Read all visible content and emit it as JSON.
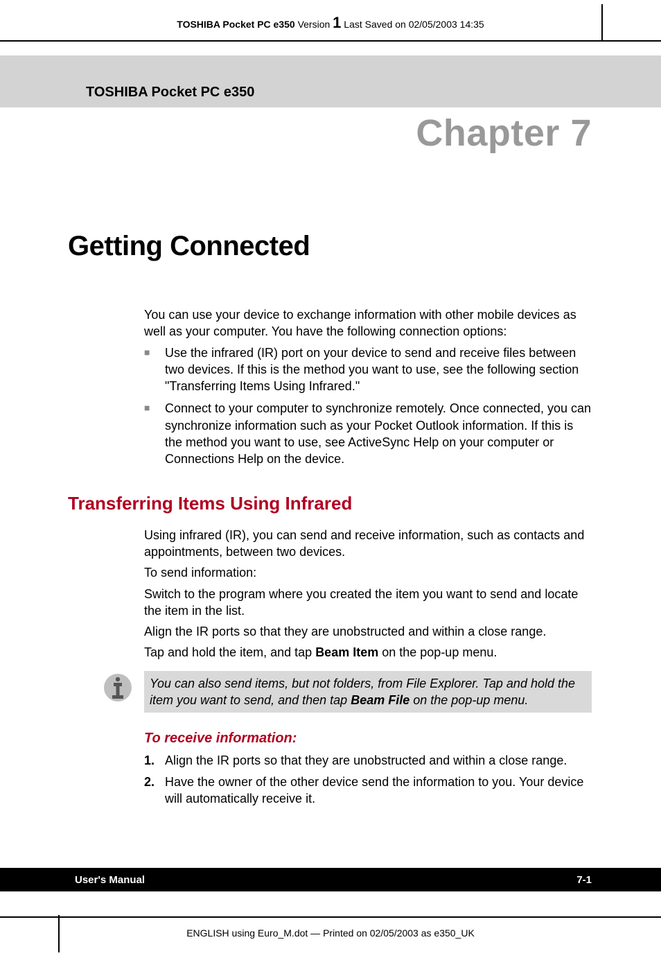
{
  "header": {
    "product_bold": "TOSHIBA Pocket PC e350",
    "version_label": " Version ",
    "version_number": "1",
    "saved_label": "  Last Saved on 02/05/2003 14:35"
  },
  "banner": {
    "product": "TOSHIBA Pocket PC e350"
  },
  "chapter_label": "Chapter 7",
  "chapter_title": "Getting Connected",
  "intro": "You can use your device to exchange information with other mobile devices as well as your computer. You have the following connection options:",
  "bullets": [
    "Use the infrared (IR) port on your device to send and receive files between two devices. If this is the method you want to use, see the following section \"Transferring Items Using Infrared.\"",
    "Connect to your computer to synchronize remotely. Once connected, you can synchronize information such as your Pocket Outlook information. If this is the method you want to use, see ActiveSync Help on your computer or Connections Help on the device."
  ],
  "section_title": "Transferring Items Using Infrared",
  "section_body": {
    "p1": "Using infrared (IR), you can send and receive information, such as contacts and appointments, between two devices.",
    "p2": "To send information:",
    "p3": "Switch to the program where you created the item you want to send and locate the item in the list.",
    "p4": "Align the IR ports so that they are unobstructed and within a close range.",
    "p5_prefix": "Tap and hold the item, and tap ",
    "p5_bold": "Beam Item",
    "p5_suffix": " on the pop-up menu."
  },
  "info_note": {
    "text_prefix": "You can also send items, but not folders, from File Explorer. Tap and hold the item you want to send, and then tap ",
    "text_bold": "Beam File",
    "text_suffix": " on the pop-up menu."
  },
  "receive_title": "To receive information:",
  "receive_steps": [
    {
      "num": "1.",
      "text": "Align the IR ports so that they are unobstructed and within a close range."
    },
    {
      "num": "2.",
      "text": "Have the owner of the other device send the information to you. Your device will automatically receive it."
    }
  ],
  "footer": {
    "left": "User's Manual",
    "right": "7-1"
  },
  "bottom_line": "ENGLISH using Euro_M.dot — Printed on 02/05/2003 as e350_UK"
}
